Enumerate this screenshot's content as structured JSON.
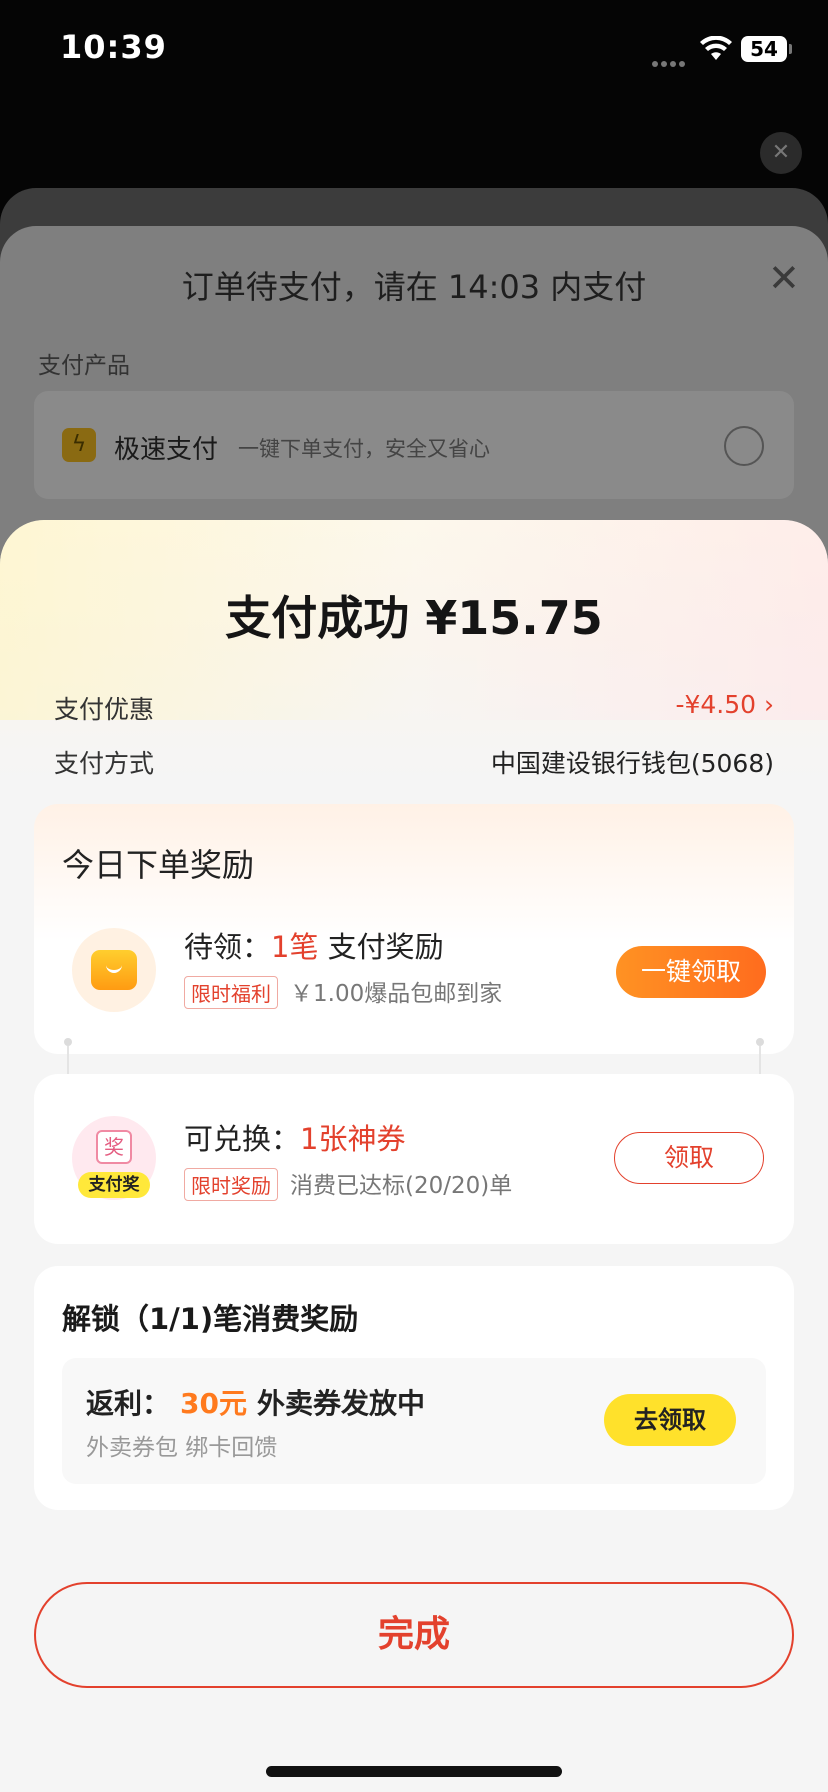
{
  "status_bar": {
    "time": "10:39",
    "battery": "54"
  },
  "background": {
    "sheet_title": "订单待支付，请在 14:03 内支付",
    "section_label": "支付产品",
    "product_name": "极速支付",
    "product_desc": "一键下单支付，安全又省心"
  },
  "result": {
    "headline": "支付成功 ¥15.75",
    "discount_label": "支付优惠",
    "discount_value": "-¥4.50",
    "method_label": "支付方式",
    "method_value": "中国建设银行钱包(5068)"
  },
  "reward_card": {
    "title": "今日下单奖励",
    "pending_prefix": "待领：",
    "pending_count": "1笔",
    "pending_suffix": " 支付奖励",
    "tag": "限时福利",
    "desc": "￥1.00爆品包邮到家",
    "button": "一键领取"
  },
  "exchange_card": {
    "icon_char": "奖",
    "icon_badge": "支付奖",
    "prefix": "可兑换：",
    "count": "1张神券",
    "tag": "限时奖励",
    "desc": "消费已达标(20/20)单",
    "button": "领取"
  },
  "unlock_card": {
    "title": "解锁（1/1)笔消费奖励",
    "prefix": "返利：",
    "amount": "30元",
    "suffix": "外卖券发放中",
    "sub": "外卖券包 绑卡回馈",
    "button": "去领取"
  },
  "done_button": "完成",
  "colors": {
    "accent_red": "#e3412d",
    "accent_orange": "#ff7a1e",
    "button_yellow": "#ffe12b"
  }
}
